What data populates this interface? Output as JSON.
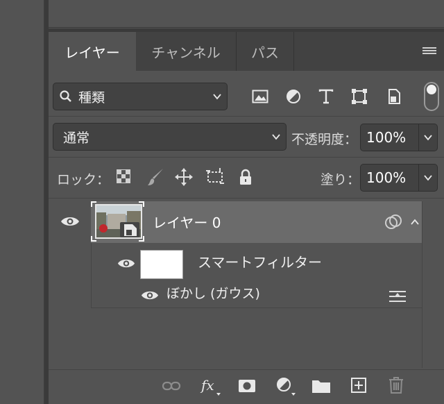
{
  "tabs": [
    {
      "label": "レイヤー",
      "active": true
    },
    {
      "label": "チャンネル",
      "active": false
    },
    {
      "label": "パス",
      "active": false
    }
  ],
  "filter": {
    "kind_label": "種類"
  },
  "blend": {
    "mode": "通常",
    "opacity_label": "不透明度：",
    "opacity_value": "100%"
  },
  "lock": {
    "label": "ロック：",
    "fill_label": "塗り：",
    "fill_value": "100%"
  },
  "layers": [
    {
      "name": "レイヤー 0",
      "smart_filter_label": "スマートフィルター",
      "filters": [
        {
          "name": "ぼかし (ガウス)"
        }
      ]
    }
  ],
  "colors": {
    "panel": "#535353",
    "tabbar": "#424242",
    "selected_layer": "#6b6b6b"
  },
  "icons": [
    "search-icon",
    "image-filter-icon",
    "adjustment-filter-icon",
    "type-filter-icon",
    "shape-filter-icon",
    "smart-object-filter-icon",
    "eye-icon",
    "link-icon",
    "fx-icon",
    "mask-icon",
    "new-adjustment-icon",
    "folder-icon",
    "new-layer-icon",
    "trash-icon"
  ]
}
